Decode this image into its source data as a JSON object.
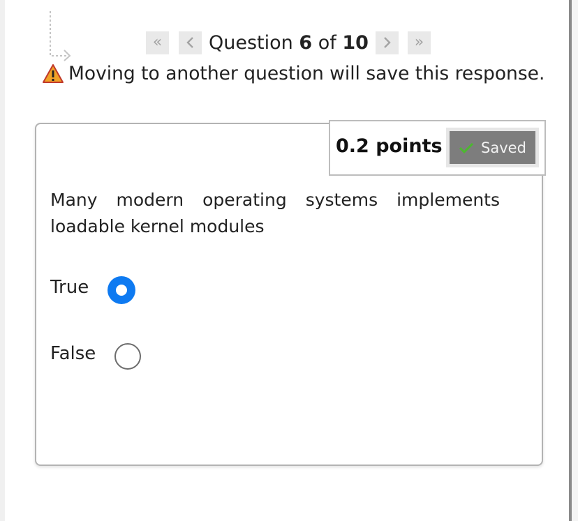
{
  "pager": {
    "first_icon": "double-chevron-left-icon",
    "prev_icon": "chevron-left-icon",
    "next_icon": "chevron-right-icon",
    "last_icon": "double-chevron-right-icon",
    "prefix": "Question",
    "current": "6",
    "of_word": "of",
    "total": "10"
  },
  "warning": {
    "icon": "warning-triangle-icon",
    "text": "Moving to another question will save this response."
  },
  "points": {
    "label": "0.2 points",
    "saved_label": "Saved",
    "saved_icon": "checkmark-icon"
  },
  "question": {
    "text": "Many modern operating systems implements loadable kernel modules"
  },
  "options": [
    {
      "label": "True",
      "selected": true
    },
    {
      "label": "False",
      "selected": false
    }
  ],
  "colors": {
    "radio_selected": "#0e7af1",
    "saved_bg": "#7d7d7d",
    "warning_orange": "#f0a227",
    "check_green": "#4cb82f"
  }
}
